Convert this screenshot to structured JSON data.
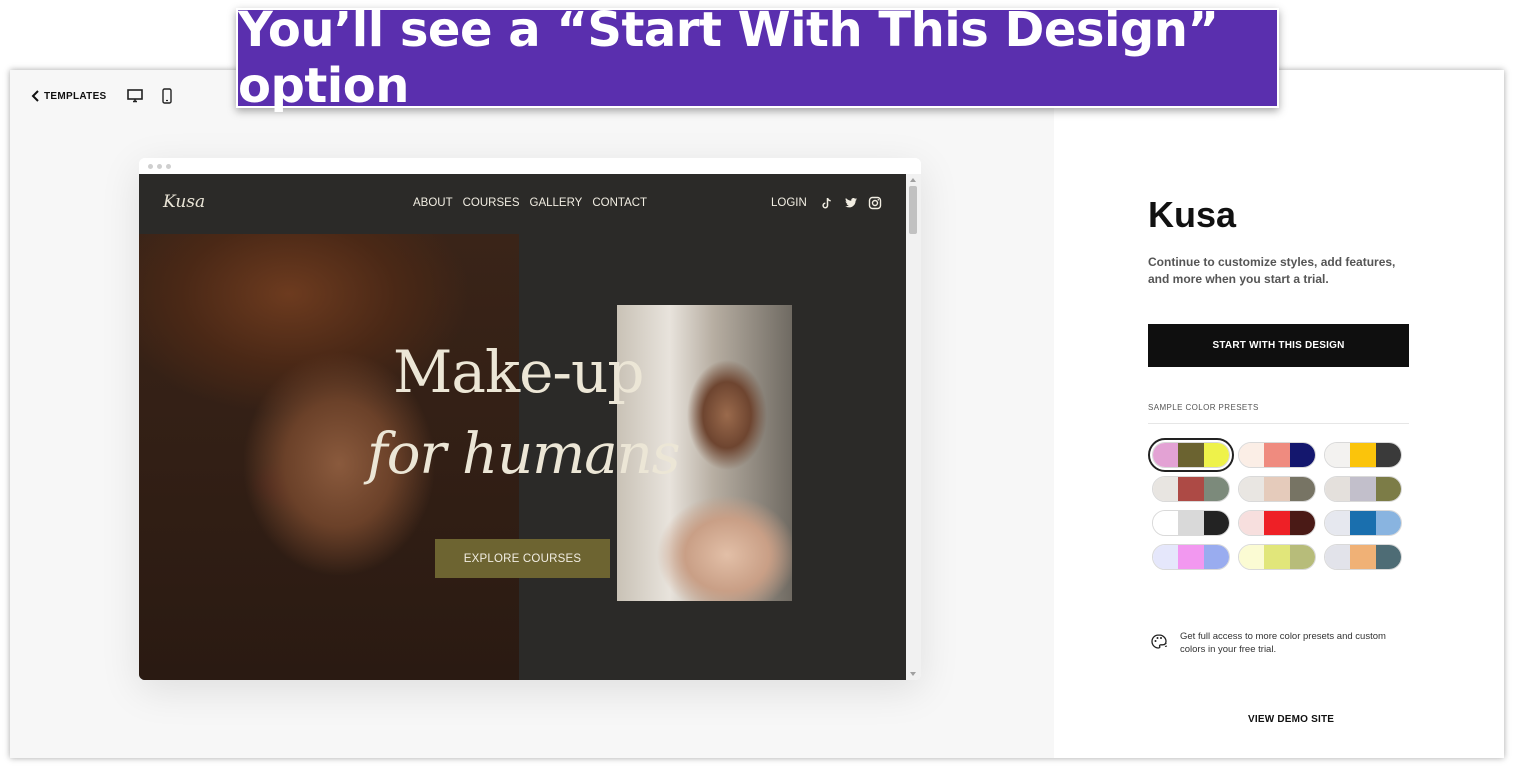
{
  "toolbar": {
    "back_label": "TEMPLATES",
    "desktop_icon": "desktop-icon",
    "mobile_icon": "mobile-icon"
  },
  "preview": {
    "logo": "Kusa",
    "nav": [
      "ABOUT",
      "COURSES",
      "GALLERY",
      "CONTACT"
    ],
    "login": "LOGIN",
    "social_icons": [
      "tiktok-icon",
      "twitter-icon",
      "instagram-icon"
    ],
    "hero_title_line1": "Make-up",
    "hero_title_line2": "for humans",
    "cta": "EXPLORE COURSES",
    "cta_color": "#6d6431",
    "background_color": "#2b2a28"
  },
  "panel": {
    "title": "Kusa",
    "description": "Continue to customize styles, add features, and more when you start a trial.",
    "start_button": "START WITH THIS DESIGN",
    "presets_label": "SAMPLE COLOR PRESETS",
    "presets": [
      {
        "colors": [
          "#e3a2d4",
          "#6b6330",
          "#eef24a"
        ],
        "selected": true
      },
      {
        "colors": [
          "#fbeee6",
          "#ef8b7f",
          "#14176e"
        ],
        "selected": false
      },
      {
        "colors": [
          "#f3f2f0",
          "#fbc40b",
          "#3a3a3a"
        ],
        "selected": false
      },
      {
        "colors": [
          "#e8e5e1",
          "#ad4a45",
          "#7c8a7b"
        ],
        "selected": false
      },
      {
        "colors": [
          "#e9e6e2",
          "#e5cbbb",
          "#777464"
        ],
        "selected": false
      },
      {
        "colors": [
          "#e4e0dc",
          "#c2bfcb",
          "#7c7c47"
        ],
        "selected": false
      },
      {
        "colors": [
          "#ffffff",
          "#d9d9d9",
          "#232323"
        ],
        "selected": false
      },
      {
        "colors": [
          "#f7dfde",
          "#ee2026",
          "#4a1a16"
        ],
        "selected": false
      },
      {
        "colors": [
          "#e6e8ef",
          "#1a6fae",
          "#89b4e0"
        ],
        "selected": false
      },
      {
        "colors": [
          "#e5e7fb",
          "#f298f0",
          "#99acef"
        ],
        "selected": false
      },
      {
        "colors": [
          "#fbfbd3",
          "#e1e67a",
          "#b7bc7a"
        ],
        "selected": false
      },
      {
        "colors": [
          "#e2e3ea",
          "#f0b176",
          "#4e6c75"
        ],
        "selected": false
      }
    ],
    "upsell_icon": "palette-icon",
    "upsell_text": "Get full access to more color presets and custom colors in your free trial.",
    "demo_link": "VIEW DEMO SITE"
  },
  "banner": {
    "text": "You’ll see a “Start With This Design” option",
    "color": "#5a2fae"
  }
}
